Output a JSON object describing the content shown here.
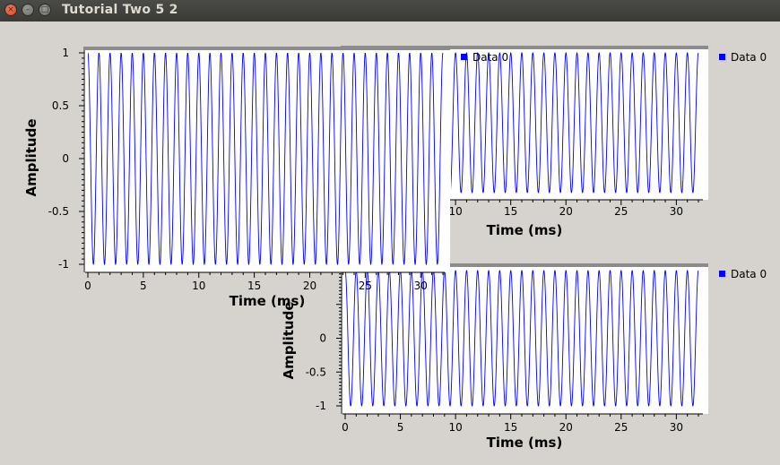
{
  "window": {
    "title": "Tutorial Two 5 2",
    "close_glyph": "×",
    "min_glyph": "–",
    "max_glyph": "□"
  },
  "chart_data": [
    {
      "type": "line",
      "title": "",
      "xlabel": "Time (ms)",
      "ylabel": "Amplitude",
      "xlim": [
        0,
        32
      ],
      "ylim": [
        -1,
        1
      ],
      "xticks": [
        0,
        5,
        10,
        15,
        20,
        25,
        30
      ],
      "yticks": [
        -1,
        -0.5,
        0,
        0.5,
        1
      ],
      "ytick_labels": [
        "-1",
        "-0.5",
        "0",
        "0.5",
        "1"
      ],
      "series": [
        {
          "name": "Data 0",
          "waveform": "cosine",
          "cycles_per_ms": 1,
          "amplitude": 1,
          "color": "#0000ff"
        }
      ],
      "grid": false,
      "legend": "top-right"
    },
    {
      "type": "line",
      "title": "",
      "xlabel": "Time (ms)",
      "ylabel": "",
      "xlim": [
        0,
        32
      ],
      "ylim": [
        -1,
        1
      ],
      "xticks": [
        10,
        15,
        20,
        25,
        30
      ],
      "series": [
        {
          "name": "Data 0",
          "waveform": "cosine",
          "cycles_per_ms": 1,
          "amplitude": 1,
          "color": "#0000ff"
        }
      ],
      "grid": false,
      "legend": "top-right"
    },
    {
      "type": "line",
      "title": "",
      "xlabel": "Time (ms)",
      "ylabel": "Amplitude",
      "xlim": [
        0,
        32
      ],
      "ylim": [
        -1,
        1
      ],
      "xticks": [
        0,
        5,
        10,
        15,
        20,
        25,
        30
      ],
      "yticks": [
        -1,
        -0.5,
        0
      ],
      "ytick_labels": [
        "-1",
        "-0.5",
        "0"
      ],
      "series": [
        {
          "name": "Data 0",
          "waveform": "cosine",
          "cycles_per_ms": 1,
          "amplitude": 1,
          "color": "#0000ff"
        }
      ],
      "grid": false,
      "legend": "top-right"
    }
  ]
}
